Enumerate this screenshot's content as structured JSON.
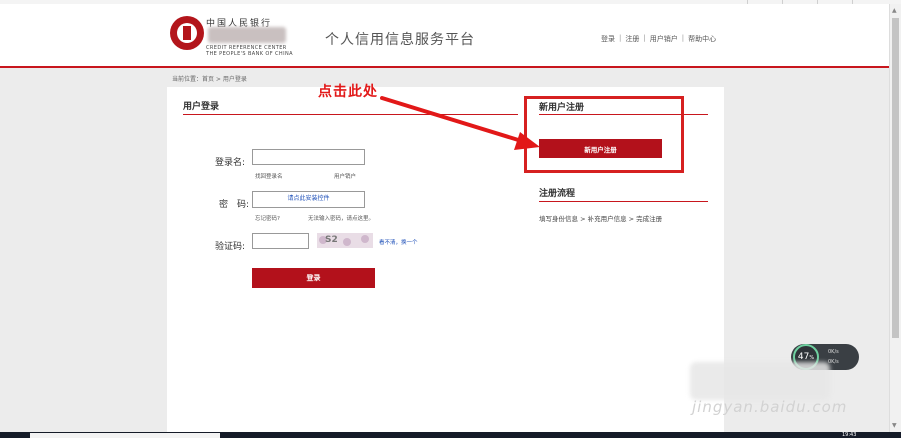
{
  "header": {
    "logo_text_cn": "中国人民银行",
    "logo_en_1": "CREDIT REFERENCE CENTER",
    "logo_en_2": "THE PEOPLE'S BANK OF CHINA",
    "site_title": "个人信用信息服务平台",
    "nav": [
      {
        "label": "登录"
      },
      {
        "label": "注册"
      },
      {
        "label": "用户销户"
      },
      {
        "label": "帮助中心"
      }
    ],
    "nav_separator": "|"
  },
  "breadcrumb": "当前位置：首页 > 用户登录",
  "login": {
    "title": "用户登录",
    "username_label": "登录名:",
    "username_value": "",
    "find_username": "找回登录名",
    "deactivate_user": "用户销户",
    "password_label": "密　码:",
    "password_prompt": "请点此安装控件",
    "forgot_password": "忘记密码?",
    "cannot_input": "无法输入密码，请点这里。",
    "captcha_label": "验证码:",
    "captcha_value": "",
    "captcha_image_text": "S2",
    "captcha_refresh": "看不清，换一个",
    "login_button": "登录"
  },
  "register": {
    "title": "新用户注册",
    "button": "新用户注册",
    "flow_title": "注册流程",
    "flow_steps": "填写身份信息 > 补充用户信息 > 完成注册"
  },
  "annotation": {
    "text": "点击此处",
    "color": "#e21818"
  },
  "speed_widget": {
    "percent": "47",
    "unit": "%",
    "up": "0K/s",
    "down": "0K/s"
  },
  "watermark": "jingyan.baidu.com",
  "taskbar": {
    "clock": "19:43"
  },
  "colors": {
    "brand_red": "#c8161d",
    "button_red": "#b3111b",
    "link_blue": "#1d4fb8",
    "page_grey": "#ececec"
  }
}
